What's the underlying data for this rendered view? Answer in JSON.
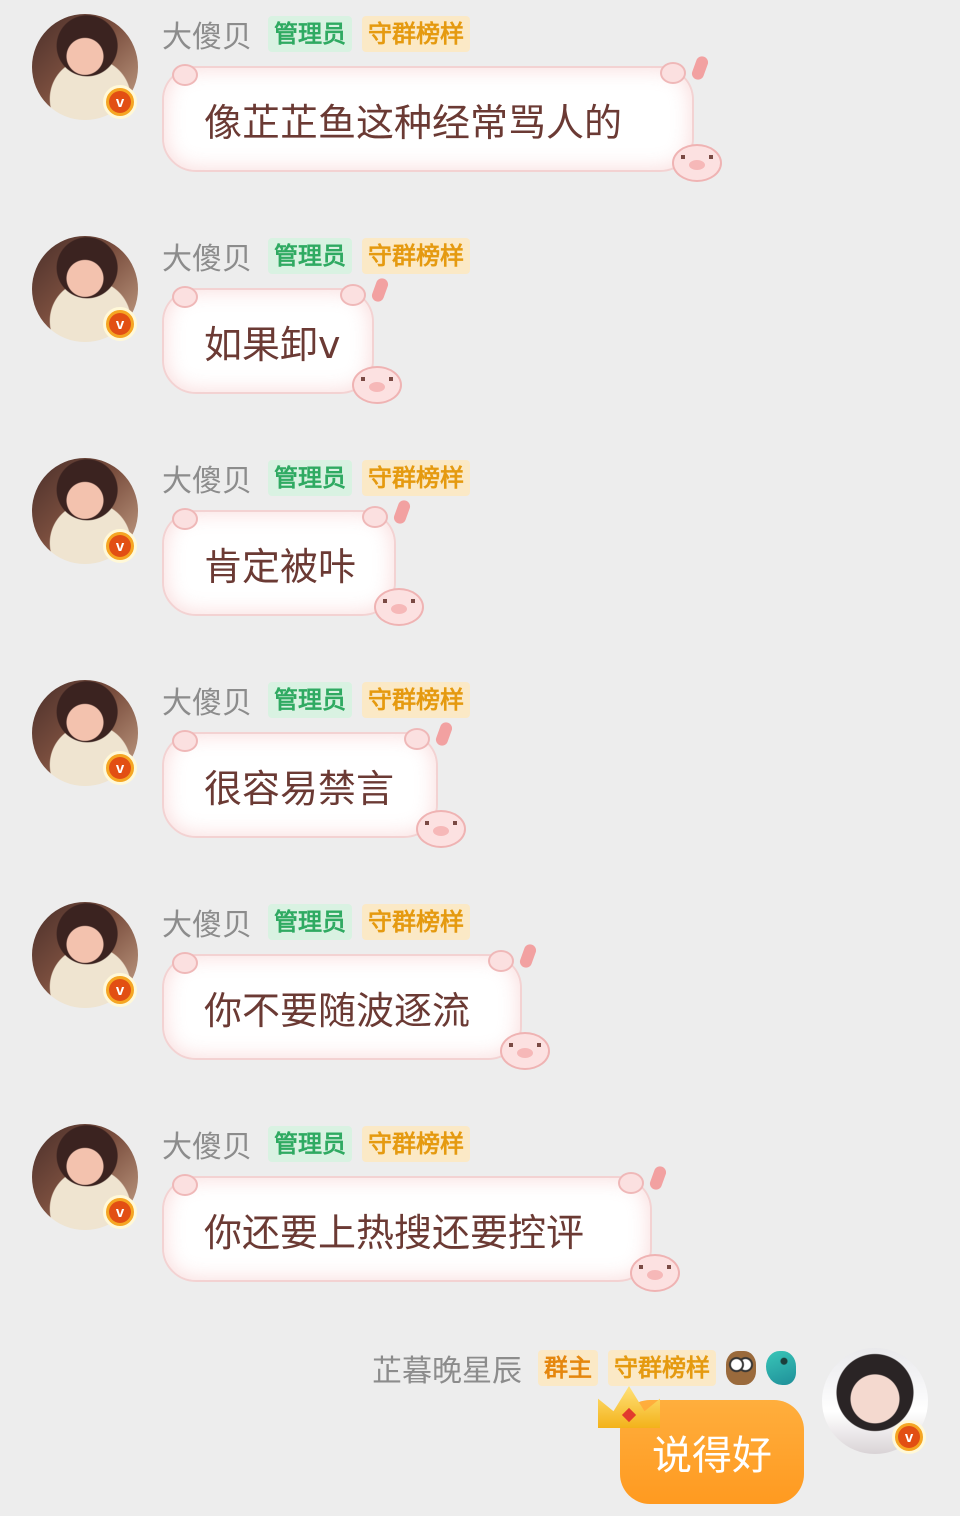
{
  "messages": [
    {
      "sender": "大傻贝",
      "tags": [
        "管理员",
        "守群榜样"
      ],
      "text": "像芷芷鱼这种经常骂人的",
      "bubble_width": 532
    },
    {
      "sender": "大傻贝",
      "tags": [
        "管理员",
        "守群榜样"
      ],
      "text": "如果卸v"
    },
    {
      "sender": "大傻贝",
      "tags": [
        "管理员",
        "守群榜样"
      ],
      "text": "肯定被咔"
    },
    {
      "sender": "大傻贝",
      "tags": [
        "管理员",
        "守群榜样"
      ],
      "text": "很容易禁言"
    },
    {
      "sender": "大傻贝",
      "tags": [
        "管理员",
        "守群榜样"
      ],
      "text": "你不要随波逐流"
    },
    {
      "sender": "大傻贝",
      "tags": [
        "管理员",
        "守群榜样"
      ],
      "text": "你还要上热搜还要控评"
    }
  ],
  "self_message": {
    "sender": "芷暮晚星辰",
    "tags": [
      "群主",
      "守群榜样"
    ],
    "icons": [
      "owl-icon",
      "bird-icon"
    ],
    "text": "说得好"
  },
  "badge_letter": "v",
  "colors": {
    "background": "#ededed",
    "admin_tag": "#2faa62",
    "model_tag": "#e59a10",
    "self_bubble": "#ff9a20",
    "bubble_text": "#6b3a34"
  }
}
